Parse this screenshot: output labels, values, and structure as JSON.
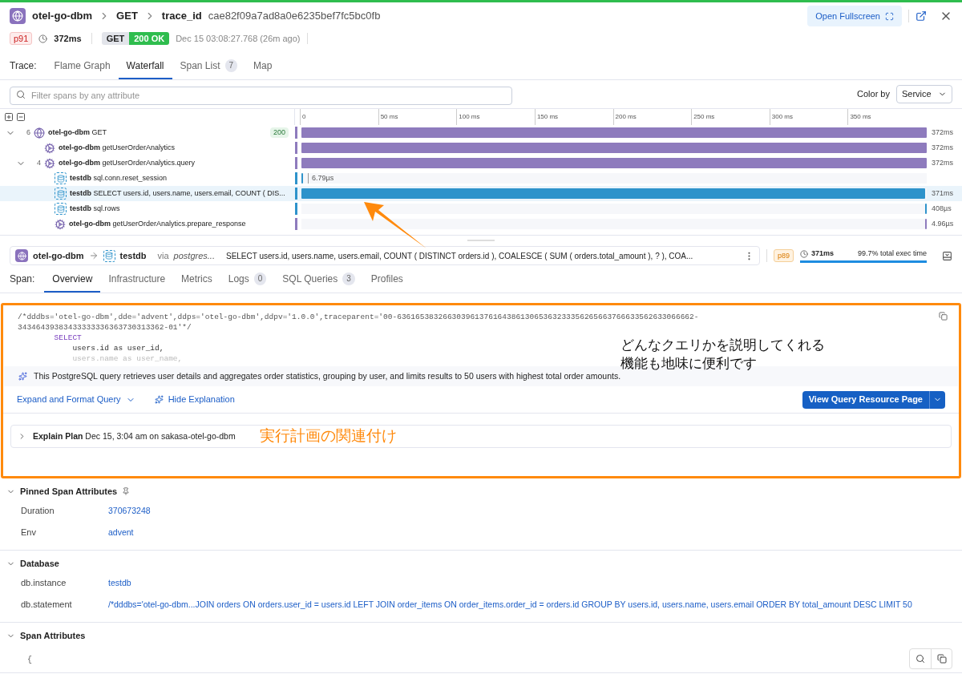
{
  "header": {
    "service": "otel-go-dbm",
    "breadcrumbs": [
      "GET",
      "trace_id"
    ],
    "trace_id": "cae82f09a7ad8a0e6235bef7fc5bc0fb",
    "fullscreen_button": "Open Fullscreen"
  },
  "meta": {
    "percentile": "p91",
    "duration": "372ms",
    "method": "GET",
    "status": "200 OK",
    "timestamp": "Dec 15 03:08:27.768 (26m ago)"
  },
  "trace_tabs": {
    "label": "Trace:",
    "tabs": [
      {
        "label": "Flame Graph",
        "selected": false
      },
      {
        "label": "Waterfall",
        "selected": true
      },
      {
        "label": "Span List",
        "count": "7",
        "selected": false
      },
      {
        "label": "Map",
        "selected": false
      }
    ]
  },
  "filter": {
    "placeholder": "Filter spans by any attribute"
  },
  "color_by": {
    "label": "Color by",
    "value": "Service"
  },
  "waterfall": {
    "ticks": [
      "0",
      "50 ms",
      "100 ms",
      "150 ms",
      "200 ms",
      "250 ms",
      "300 ms",
      "350 ms"
    ],
    "spans": [
      {
        "service": "otel-go-dbm",
        "operation": "GET",
        "kind": "web",
        "color": "#8e7bbd",
        "count": "6",
        "status": "200",
        "expanded": true,
        "selected": false,
        "bar": {
          "level": 1
        },
        "duration": "372ms",
        "children": [
          {
            "service": "otel-go-dbm",
            "operation": "getUserOrderAnalytics",
            "kind": "custom",
            "color": "#8e7bbd",
            "selected": false,
            "bar": {
              "level": 1
            },
            "duration": "372ms"
          },
          {
            "service": "otel-go-dbm",
            "operation": "getUserOrderAnalytics.query",
            "kind": "custom",
            "color": "#8e7bbd",
            "count": "4",
            "expanded": true,
            "selected": false,
            "bar": {
              "level": 1
            },
            "duration": "372ms",
            "children": [
              {
                "service": "testdb",
                "operation": "sql.conn.reset_session",
                "kind": "db",
                "color": "#2e93cb",
                "selected": false,
                "bar": {
                  "kind": "start",
                  "level": 0.003
                },
                "duration": "6.79µs"
              },
              {
                "service": "testdb",
                "operation": "SELECT users.id, users.name, users.email, COUNT ( DIS...",
                "kind": "db",
                "color": "#2e93cb",
                "selected": true,
                "bar": {
                  "kind": "start",
                  "level": 0.997
                },
                "duration": "371ms"
              },
              {
                "service": "testdb",
                "operation": "sql.rows",
                "kind": "db",
                "color": "#2e93cb",
                "selected": false,
                "bar": {
                  "kind": "end",
                  "level": 0.003
                },
                "duration": "408µs"
              },
              {
                "service": "otel-go-dbm",
                "operation": "getUserOrderAnalytics.prepare_response",
                "kind": "custom",
                "color": "#8e7bbd",
                "selected": false,
                "bar": {
                  "kind": "end",
                  "level": 0.003
                },
                "duration": "4.96µs"
              }
            ]
          }
        ]
      }
    ]
  },
  "span": {
    "from": "otel-go-dbm",
    "to": "testdb",
    "via_label": "via",
    "via": "postgres...",
    "query": "SELECT users.id, users.name, users.email, COUNT ( DISTINCT orders.id ), COALESCE ( SUM ( orders.total_amount ), ? ), COA...",
    "percentile": "p89",
    "duration": "371ms",
    "exec_share": "99.7% total exec time",
    "level": 0.997
  },
  "span_tabs": {
    "label": "Span:",
    "tabs": [
      {
        "label": "Overview",
        "selected": true
      },
      {
        "label": "Infrastructure",
        "selected": false
      },
      {
        "label": "Metrics",
        "selected": false
      },
      {
        "label": "Logs",
        "count": "0",
        "selected": false
      },
      {
        "label": "SQL Queries",
        "count": "3",
        "selected": false
      },
      {
        "label": "Profiles",
        "selected": false
      }
    ]
  },
  "query_panel": {
    "code_lines": [
      {
        "text": "/*dddbs='otel-go-dbm',dde='advent',ddps='otel-go-dbm',ddpv='1.0.0',traceparent='00-63616538326630396137616438613065363233356265663766633562633066662-",
        "kind": "comment"
      },
      {
        "text": "34346439383433333336363730313362-01'*/",
        "kind": "comment"
      },
      {
        "text": "        SELECT",
        "kind": "keyword"
      },
      {
        "text": "            users.id as user_id,",
        "kind": "plain"
      },
      {
        "text": "            users.name as user_name,",
        "kind": "faded"
      }
    ],
    "explanation": "This PostgreSQL query retrieves user details and aggregates order statistics, grouping by user, and limits results to 50 users with highest total order amounts.",
    "expand_button": "Expand and Format Query",
    "hide_button": "Hide Explanation",
    "resource_button": "View Query Resource Page",
    "explain_plan": {
      "label": "Explain Plan",
      "detail": "Dec 15, 3:04 am on sakasa-otel-go-dbm",
      "expanded": false
    }
  },
  "annotations": {
    "explanation_note": [
      "どんなクエリかを説明してくれる",
      "機能も地味に便利です"
    ],
    "plan_note": "実行計画の関連付け"
  },
  "sections": [
    {
      "title": "Pinned Span Attributes",
      "kind": "pinned",
      "expanded": true,
      "rows": [
        {
          "key": "Duration",
          "value": "370673248"
        },
        {
          "key": "Env",
          "value": "advent"
        }
      ]
    },
    {
      "title": "Database",
      "kind": "plain",
      "expanded": true,
      "rows": [
        {
          "key": "db.instance",
          "value": "testdb"
        },
        {
          "key": "db.statement",
          "value": "/*dddbs='otel-go-dbm...JOIN orders ON orders.user_id = users.id LEFT JOIN order_items ON order_items.order_id = orders.id GROUP BY users.id, users.name, users.email ORDER BY total_amount DESC LIMIT 50"
        }
      ]
    },
    {
      "title": "Span Attributes",
      "kind": "plain",
      "expanded": true,
      "json_lines": [
        "{"
      ]
    }
  ]
}
